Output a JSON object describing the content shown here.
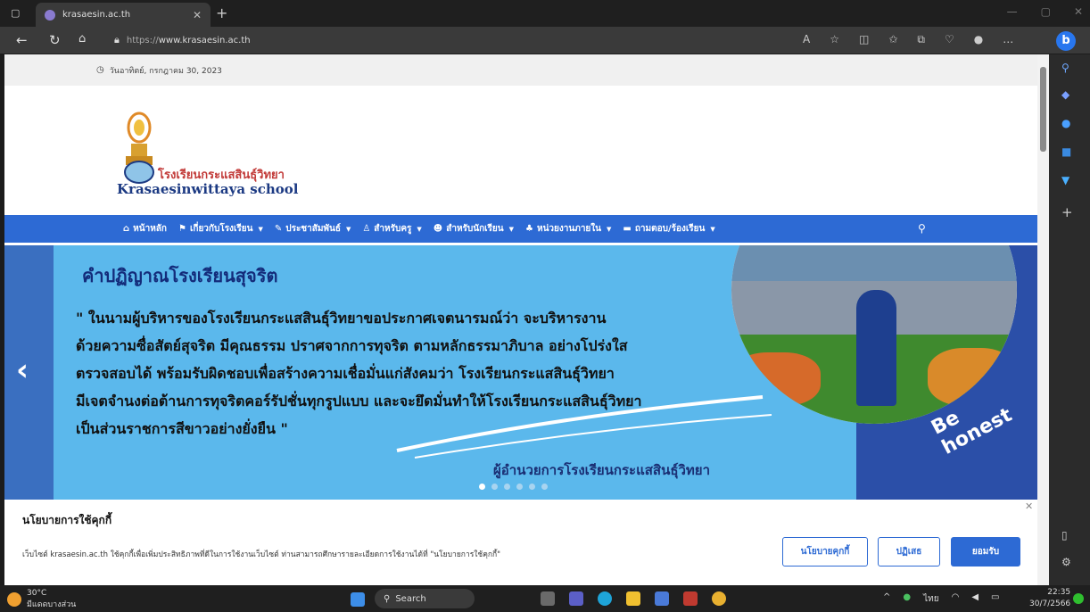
{
  "browser": {
    "tab_title": "krasaesin.ac.th",
    "url_scheme": "https://",
    "url_host": "www.krasaesin.ac.th"
  },
  "site": {
    "date": "วันอาทิตย์, กรกฎาคม 30, 2023",
    "logo_th": "โรงเรียนกระแสสินธุ์วิทยา",
    "logo_en": "Krasaesinwittaya school",
    "menu": [
      {
        "label": "หน้าหลัก",
        "icon": "home-icon"
      },
      {
        "label": "เกี่ยวกับโรงเรียน",
        "icon": "flag-icon"
      },
      {
        "label": "ประชาสัมพันธ์",
        "icon": "megaphone-icon"
      },
      {
        "label": "สำหรับครู",
        "icon": "user-icon"
      },
      {
        "label": "สำหรับนักเรียน",
        "icon": "student-icon"
      },
      {
        "label": "หน่วยงานภายใน",
        "icon": "org-icon"
      },
      {
        "label": "ถามตอบ/ร้องเรียน",
        "icon": "chat-icon"
      }
    ]
  },
  "slide": {
    "title": "คำปฏิญาณโรงเรียนสุจริต",
    "quote_lines": [
      "\" ในนามผู้บริหารของโรงเรียนกระแสสินธุ์วิทยาขอประกาศเจตนารมณ์ว่า จะบริหารงาน",
      "ด้วยความซื่อสัตย์สุจริต มีคุณธรรม ปราศจากการทุจริต ตามหลักธรรมาภิบาล อย่างโปร่งใส",
      "ตรวจสอบได้ พร้อมรับผิดชอบเพื่อสร้างความเชื่อมั่นแก่สังคมว่า โรงเรียนกระแสสินธุ์วิทยา",
      "มีเจตจำนงต่อต้านการทุจริตคอร์รัปชั่นทุกรูปแบบ และจะยึดมั่นทำให้โรงเรียนกระแสสินธุ์วิทยา",
      "เป็นส่วนราชการสีขาวอย่างยั่งยืน \""
    ],
    "signature": "ผู้อำนวยการโรงเรียนกระแสสินธุ์วิทยา",
    "badge": "Be honest"
  },
  "cookie": {
    "title": "นโยบายการใช้คุกกี้",
    "text": "เว็บไซต์ krasaesin.ac.th ใช้คุกกี้เพื่อเพิ่มประสิทธิภาพที่ดีในการใช้งานเว็บไซต์ ท่านสามารถศึกษารายละเอียดการใช้งานได้ที่ \"นโยบายการใช้คุกกี้\"",
    "btn_policy": "นโยบายคุกกี้",
    "btn_reject": "ปฏิเสธ",
    "btn_accept": "ยอมรับ"
  },
  "taskbar": {
    "temp": "30°C",
    "weather": "มีแดดบางส่วน",
    "search": "Search",
    "lang": "ไทย",
    "time": "22:35",
    "date": "30/7/2566"
  }
}
